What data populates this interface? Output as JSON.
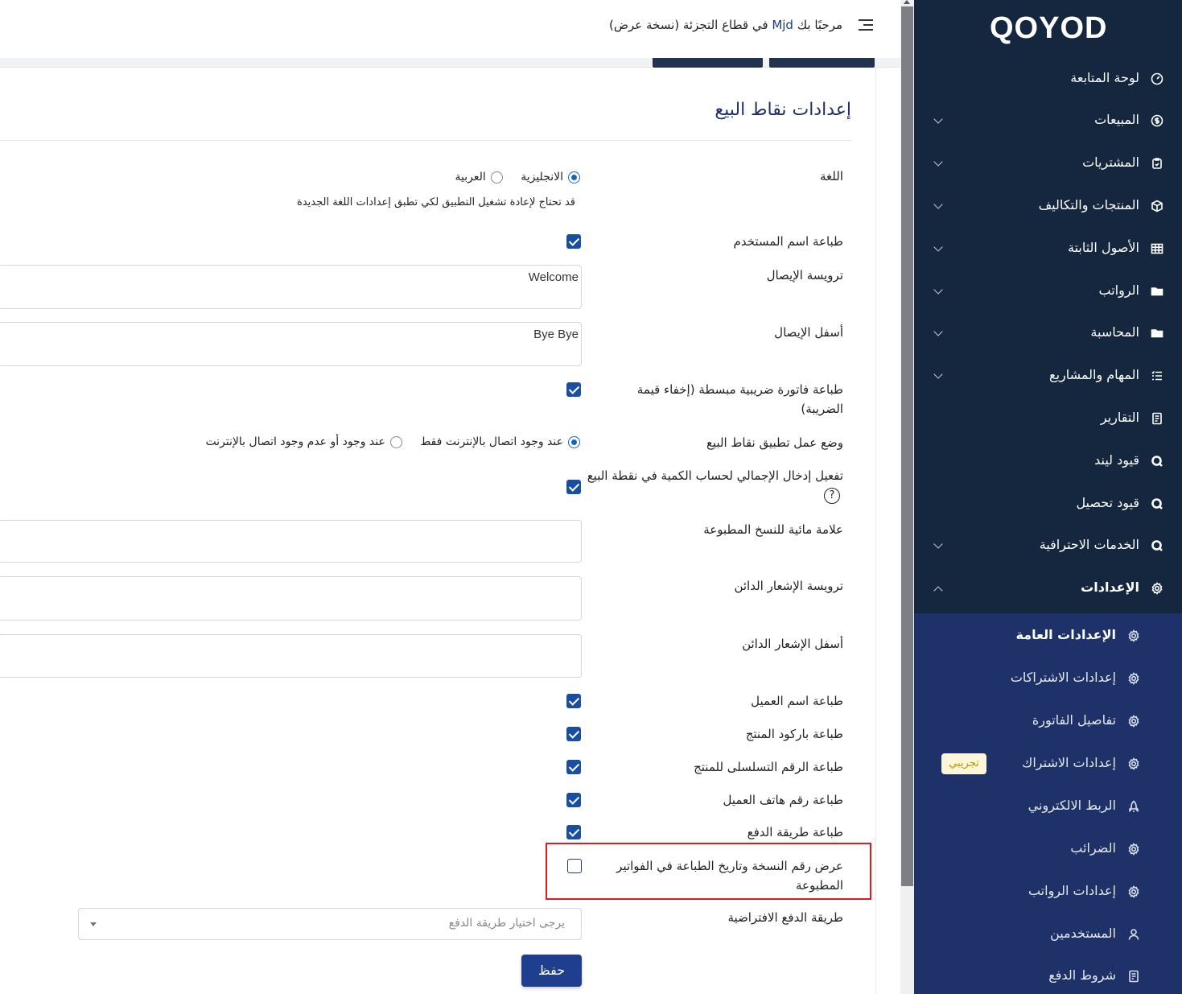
{
  "header": {
    "welcome_prefix": "مرحبًا بك",
    "username": "Mjd",
    "welcome_suffix": "في قطاع التجزئة (نسخة عرض)"
  },
  "page": {
    "title": "إعدادات نقاط البيع"
  },
  "form": {
    "language": {
      "label": "اللغة",
      "options": [
        "الانجليزية",
        "العربية"
      ],
      "selected": "الانجليزية",
      "hint": "قد تحتاج لإعادة تشغيل التطبيق لكي تطبق إعدادات اللغة الجديدة"
    },
    "print_username": {
      "label": "طباعة اسم المستخدم",
      "checked": true
    },
    "receipt_header": {
      "label": "ترويسة الإيصال",
      "value": "Welcome"
    },
    "receipt_footer": {
      "label": "أسفل الإيصال",
      "value": "Bye Bye"
    },
    "simplified_tax_invoice": {
      "label": "طباعة فاتورة ضريبية مبسطة (إخفاء قيمة الضريبة)",
      "checked": true
    },
    "pos_mode": {
      "label": "وضع عمل تطبيق نقاط البيع",
      "options": [
        "عند وجود اتصال بالإنترنت فقط",
        "عند وجود أو عدم وجود اتصال بالإنترنت"
      ],
      "selected": "عند وجود اتصال بالإنترنت فقط"
    },
    "enable_total_entry": {
      "label": "تفعيل إدخال الإجمالي لحساب الكمية في نقطة البيع",
      "help": "?",
      "checked": true
    },
    "watermark": {
      "label": "علامة مائية للنسخ المطبوعة",
      "value": ""
    },
    "credit_note_header": {
      "label": "ترويسة الإشعار الدائن",
      "value": ""
    },
    "credit_note_footer": {
      "label": "أسفل الإشعار الدائن",
      "value": ""
    },
    "print_customer_name": {
      "label": "طباعة اسم العميل",
      "checked": true
    },
    "print_product_barcode": {
      "label": "طباعة باركود المنتج",
      "checked": true
    },
    "print_product_serial": {
      "label": "طباعة الرقم التسلسلى للمنتج",
      "checked": true
    },
    "print_customer_phone": {
      "label": "طباعة رقم هاتف العميل",
      "checked": true
    },
    "print_payment_method": {
      "label": "طباعة طريقة الدفع",
      "checked": true
    },
    "show_copy_number": {
      "label": "عرض رقم النسخة وتاريخ الطباعة في الفواتير المطبوعة",
      "checked": false
    },
    "default_payment_method": {
      "label": "طريقة الدفع الافتراضية",
      "placeholder": "يرجى اختيار طريقة الدفع"
    },
    "save_label": "حفظ"
  },
  "sidebar": {
    "logo": "QOYOD",
    "items": [
      {
        "label": "لوحة المتابعة",
        "icon": "dashboard-icon",
        "expandable": false
      },
      {
        "label": "المبيعات",
        "icon": "dollar-icon",
        "expandable": true
      },
      {
        "label": "المشتريات",
        "icon": "clipboard-icon",
        "expandable": true
      },
      {
        "label": "المنتجات والتكاليف",
        "icon": "box-icon",
        "expandable": true
      },
      {
        "label": "الأصول الثابتة",
        "icon": "grid-icon",
        "expandable": true
      },
      {
        "label": "الرواتب",
        "icon": "folder-icon",
        "expandable": true
      },
      {
        "label": "المحاسبة",
        "icon": "folder-icon",
        "expandable": true
      },
      {
        "label": "المهام والمشاريع",
        "icon": "tasks-icon",
        "expandable": true
      },
      {
        "label": "التقارير",
        "icon": "report-icon",
        "expandable": false
      },
      {
        "label": "قيود ليند",
        "icon": "qoyod-icon",
        "expandable": false
      },
      {
        "label": "قيود تحصيل",
        "icon": "qoyod-icon",
        "expandable": false
      },
      {
        "label": "الخدمات الاحترافية",
        "icon": "qoyod-icon",
        "expandable": true
      },
      {
        "label": "الإعدادات",
        "icon": "gear-icon",
        "expandable": true,
        "expanded": true
      }
    ],
    "sub_items": [
      {
        "label": "الإعدادات العامة",
        "icon": "gear-icon",
        "active": true
      },
      {
        "label": "إعدادات الاشتراكات",
        "icon": "gear-icon"
      },
      {
        "label": "تفاصيل الفاتورة",
        "icon": "gear-icon"
      },
      {
        "label": "إعدادات الاشتراك",
        "icon": "gear-icon",
        "badge": "تجريبي"
      },
      {
        "label": "الربط الالكتروني",
        "icon": "rocket-icon"
      },
      {
        "label": "الضرائب",
        "icon": "gear-icon"
      },
      {
        "label": "إعدادات الرواتب",
        "icon": "gear-icon"
      },
      {
        "label": "المستخدمين",
        "icon": "user-icon"
      },
      {
        "label": "شروط الدفع",
        "icon": "document-icon"
      }
    ]
  },
  "colors": {
    "sidebar_bg": "#15263f",
    "submenu_bg": "#1e3169",
    "accent": "#1f3f8e",
    "title": "#1f2e67",
    "highlight_border": "#e0191e",
    "badge_bg": "#fdf6d8",
    "badge_text": "#c49100"
  }
}
